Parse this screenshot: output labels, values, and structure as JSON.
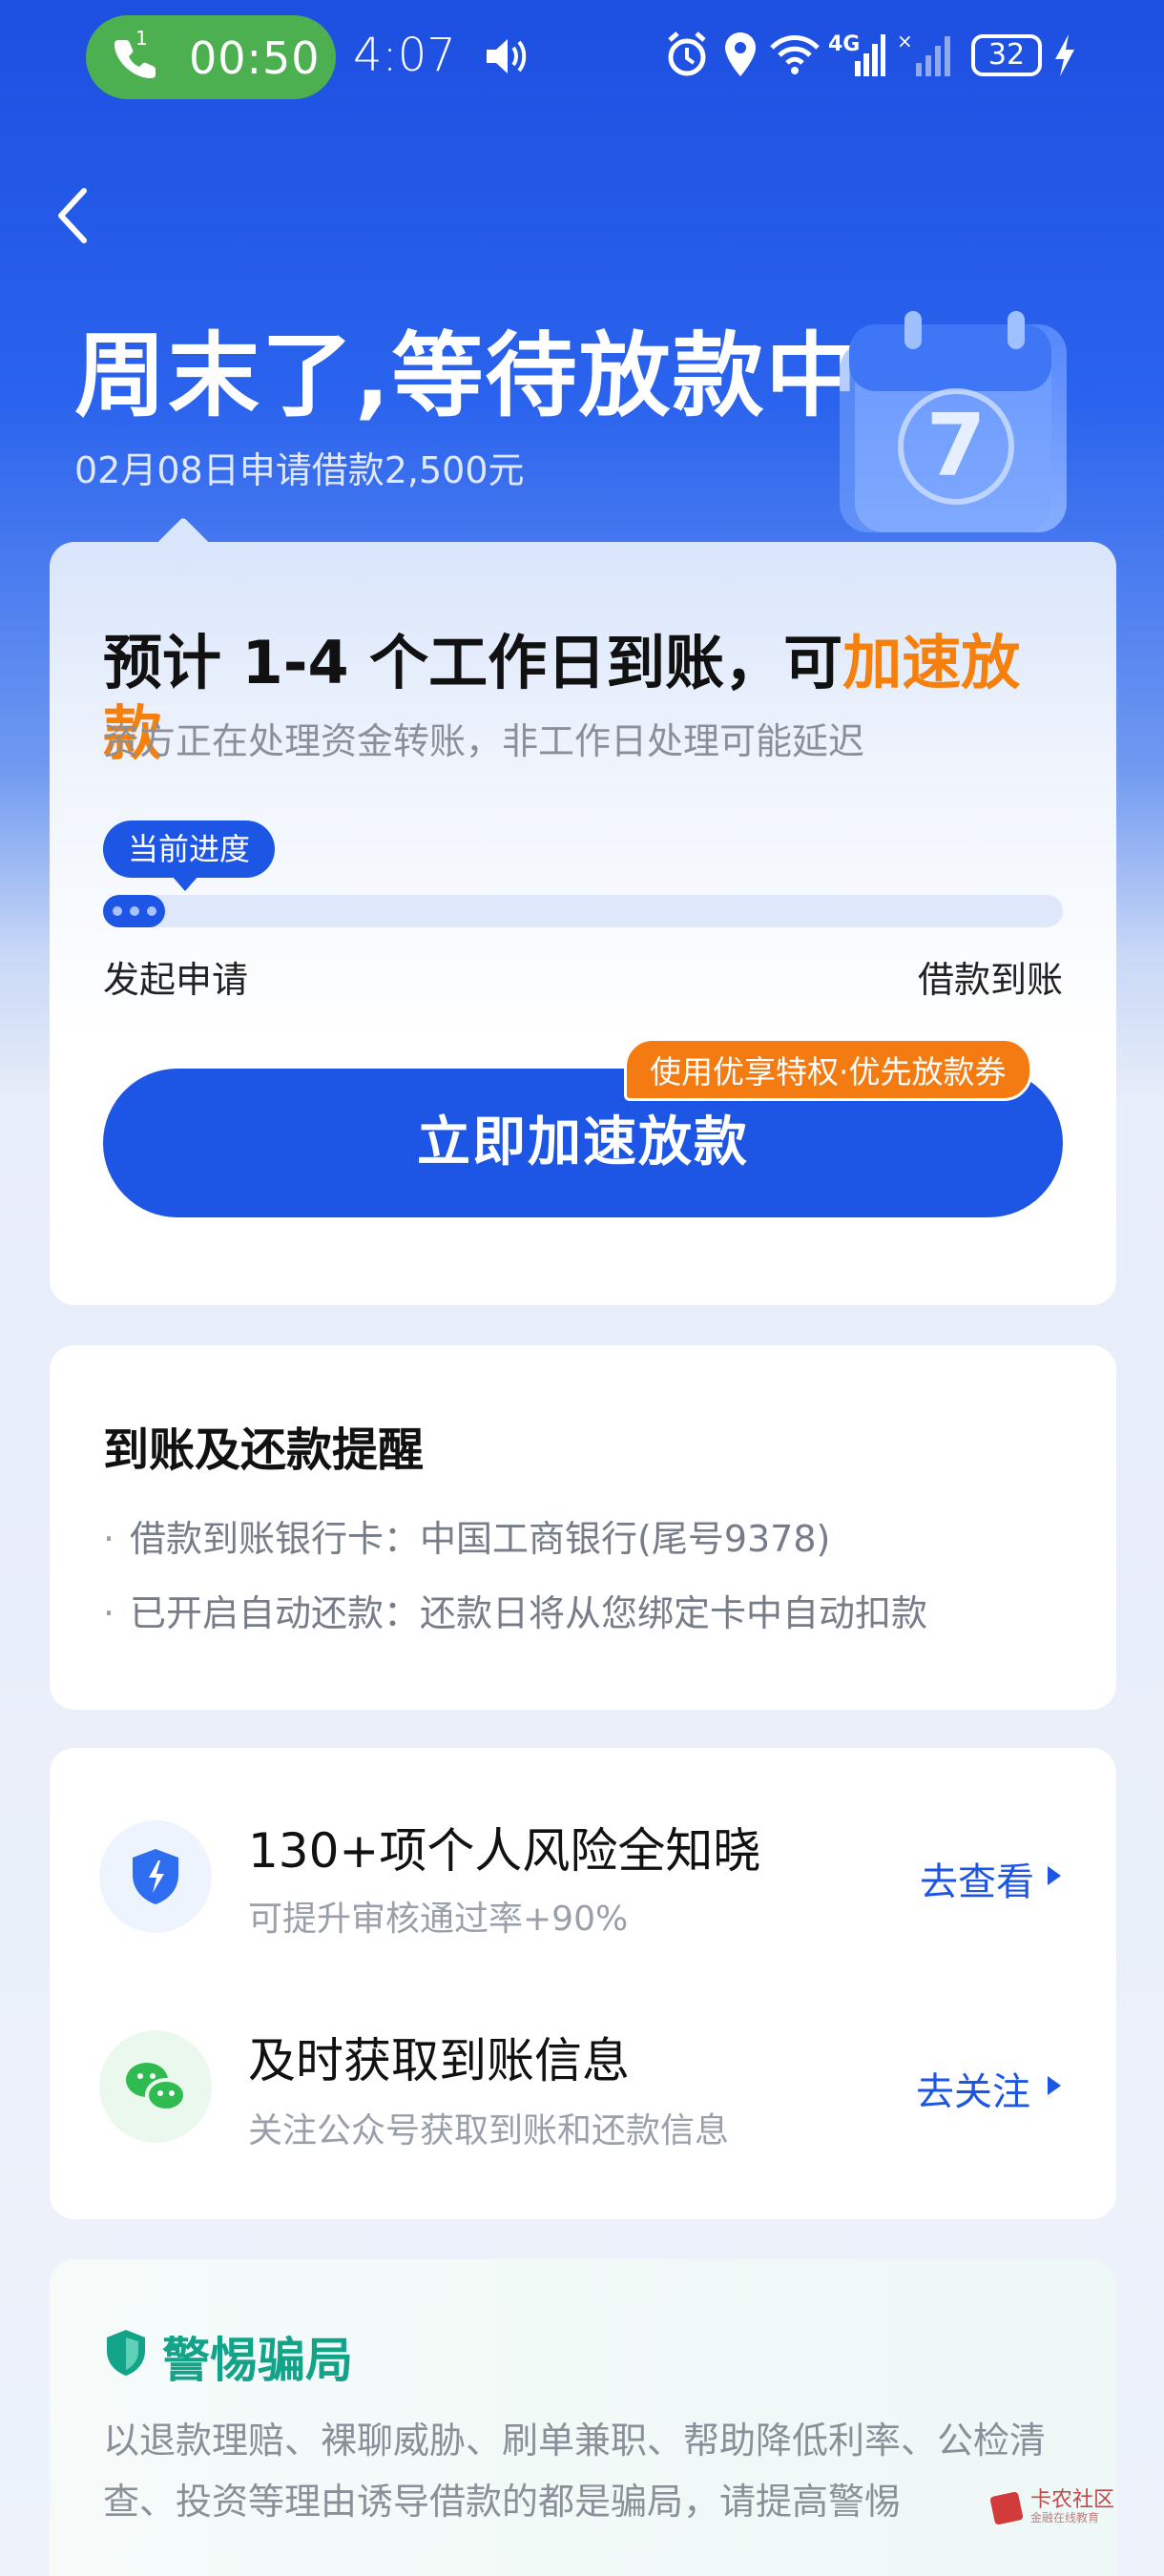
{
  "status_bar": {
    "call_sim": "1",
    "call_timer": "00:50",
    "clock": "4:07",
    "network": "4G",
    "battery": "32"
  },
  "header": {
    "title": "周末了,等待放款中",
    "subtitle": "02月08日申请借款2,500元"
  },
  "progress_card": {
    "eta_text": "预计 1-4 个工作日到账，可",
    "eta_link": "加速放款",
    "eta_sub": "资方正在处理资金转账，非工作日处理可能延迟",
    "progress_tag": "当前进度",
    "progress_fraction": 0.065,
    "step_start": "发起申请",
    "step_end": "借款到账",
    "accelerate_button": "立即加速放款",
    "coupon_badge": "使用优享特权·优先放款券"
  },
  "reminder_card": {
    "title": "到账及还款提醒",
    "items": [
      "借款到账银行卡：中国工商银行(尾号9378)",
      "已开启自动还款：还款日将从您绑定卡中自动扣款"
    ]
  },
  "features": [
    {
      "title": "130+项个人风险全知晓",
      "subtitle": "可提升审核通过率+90%",
      "link": "去查看",
      "icon": "shield-bolt-icon"
    },
    {
      "title": "及时获取到账信息",
      "subtitle": "关注公众号获取到账和还款信息",
      "link": "去关注",
      "icon": "wechat-icon"
    }
  ],
  "fraud_card": {
    "title": "警惕骗局",
    "text": "以退款理赔、裸聊威胁、刷单兼职、帮助降低利率、公检清查、投资等理由诱导借款的都是骗局，请提高警惕"
  },
  "watermark": {
    "text": "卡农社区",
    "subtext": "金融在线教育"
  },
  "colors": {
    "primary": "#1d55e4",
    "accent": "#f5800e",
    "fraud": "#12a388",
    "call_pill": "#4caf50"
  }
}
